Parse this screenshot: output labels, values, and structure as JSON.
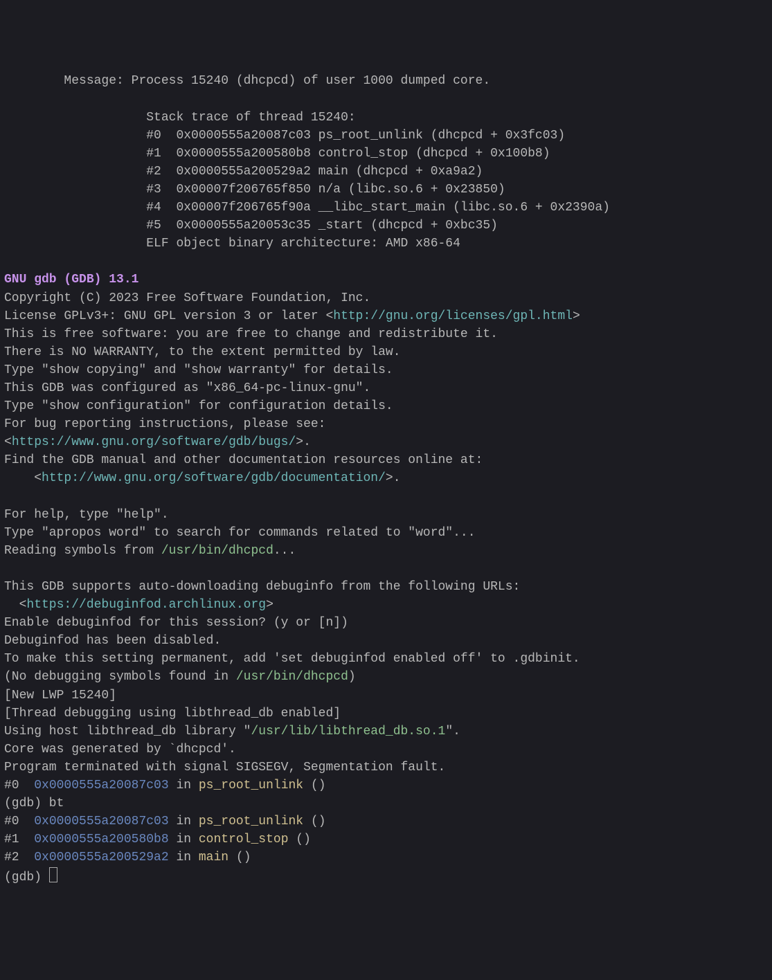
{
  "header_indent": "        ",
  "trace_indent": "                   ",
  "msg_prefix": "Message: ",
  "msg_text": "Process 15240 (dhcpcd) of user 1000 dumped core.",
  "blank": "",
  "stack_title": "Stack trace of thread 15240:",
  "frames": [
    "#0  0x0000555a20087c03 ps_root_unlink (dhcpcd + 0x3fc03)",
    "#1  0x0000555a200580b8 control_stop (dhcpcd + 0x100b8)",
    "#2  0x0000555a200529a2 main (dhcpcd + 0xa9a2)",
    "#3  0x00007f206765f850 n/a (libc.so.6 + 0x23850)",
    "#4  0x00007f206765f90a __libc_start_main (libc.so.6 + 0x2390a)",
    "#5  0x0000555a20053c35 _start (dhcpcd + 0xbc35)"
  ],
  "elf_line": "ELF object binary architecture: AMD x86-64",
  "gdb_title": "GNU gdb (GDB) 13.1",
  "body_pre1": "Copyright (C) 2023 Free Software Foundation, Inc.\nLicense GPLv3+: GNU GPL version 3 or later <",
  "gpl_url": "http://gnu.org/licenses/gpl.html",
  "body_post1": ">\nThis is free software: you are free to change and redistribute it.\nThere is NO WARRANTY, to the extent permitted by law.\nType \"show copying\" and \"show warranty\" for details.\nThis GDB was configured as \"x86_64-pc-linux-gnu\".\nType \"show configuration\" for configuration details.\nFor bug reporting instructions, please see:\n<",
  "bugs_url": "https://www.gnu.org/software/gdb/bugs/",
  "body_line_aftbugs": ">.\nFind the GDB manual and other documentation resources online at:\n    <",
  "doc_url": "http://www.gnu.org/software/gdb/documentation/",
  "body_line_aftdoc": ">.\n\nFor help, type \"help\".\nType \"apropos word\" to search for commands related to \"word\"...\nReading symbols from ",
  "dhcpcd_path": "/usr/bin/dhcpcd",
  "ellipsis": "...",
  "body_autodl": "\nThis GDB supports auto-downloading debuginfo from the following URLs:\n  <",
  "debuginfod_url": "https://debuginfod.archlinux.org",
  "body_enable": ">\nEnable debuginfod for this session? (y or [n])\nDebuginfod has been disabled.\nTo make this setting permanent, add 'set debuginfod enabled off' to .gdbinit.\n(No debugging symbols found in ",
  "dhcpcd_path2": "/usr/bin/dhcpcd",
  "close_paren": ")\n[New LWP 15240]\n[Thread debugging using libthread_db enabled]\nUsing host libthread_db library \"",
  "pthread_path": "/usr/lib/libthread_db.so.1",
  "after_pthread": "\".\nCore was generated by `dhcpcd'.\nProgram terminated with signal SIGSEGV, Segmentation fault.\n",
  "bt0_pre": "#0  ",
  "bt0_addr": "0x0000555a20087c03",
  "in_word": " in ",
  "bt0_func": "ps_root_unlink",
  "parens": " ()",
  "gdb_prompt_bt": "(gdb) bt",
  "bt_lines": [
    {
      "n": "#0  ",
      "addr": "0x0000555a20087c03",
      "fn": "ps_root_unlink"
    },
    {
      "n": "#1  ",
      "addr": "0x0000555a200580b8",
      "fn": "control_stop"
    },
    {
      "n": "#2  ",
      "addr": "0x0000555a200529a2",
      "fn": "main"
    }
  ],
  "gdb_prompt": "(gdb) "
}
